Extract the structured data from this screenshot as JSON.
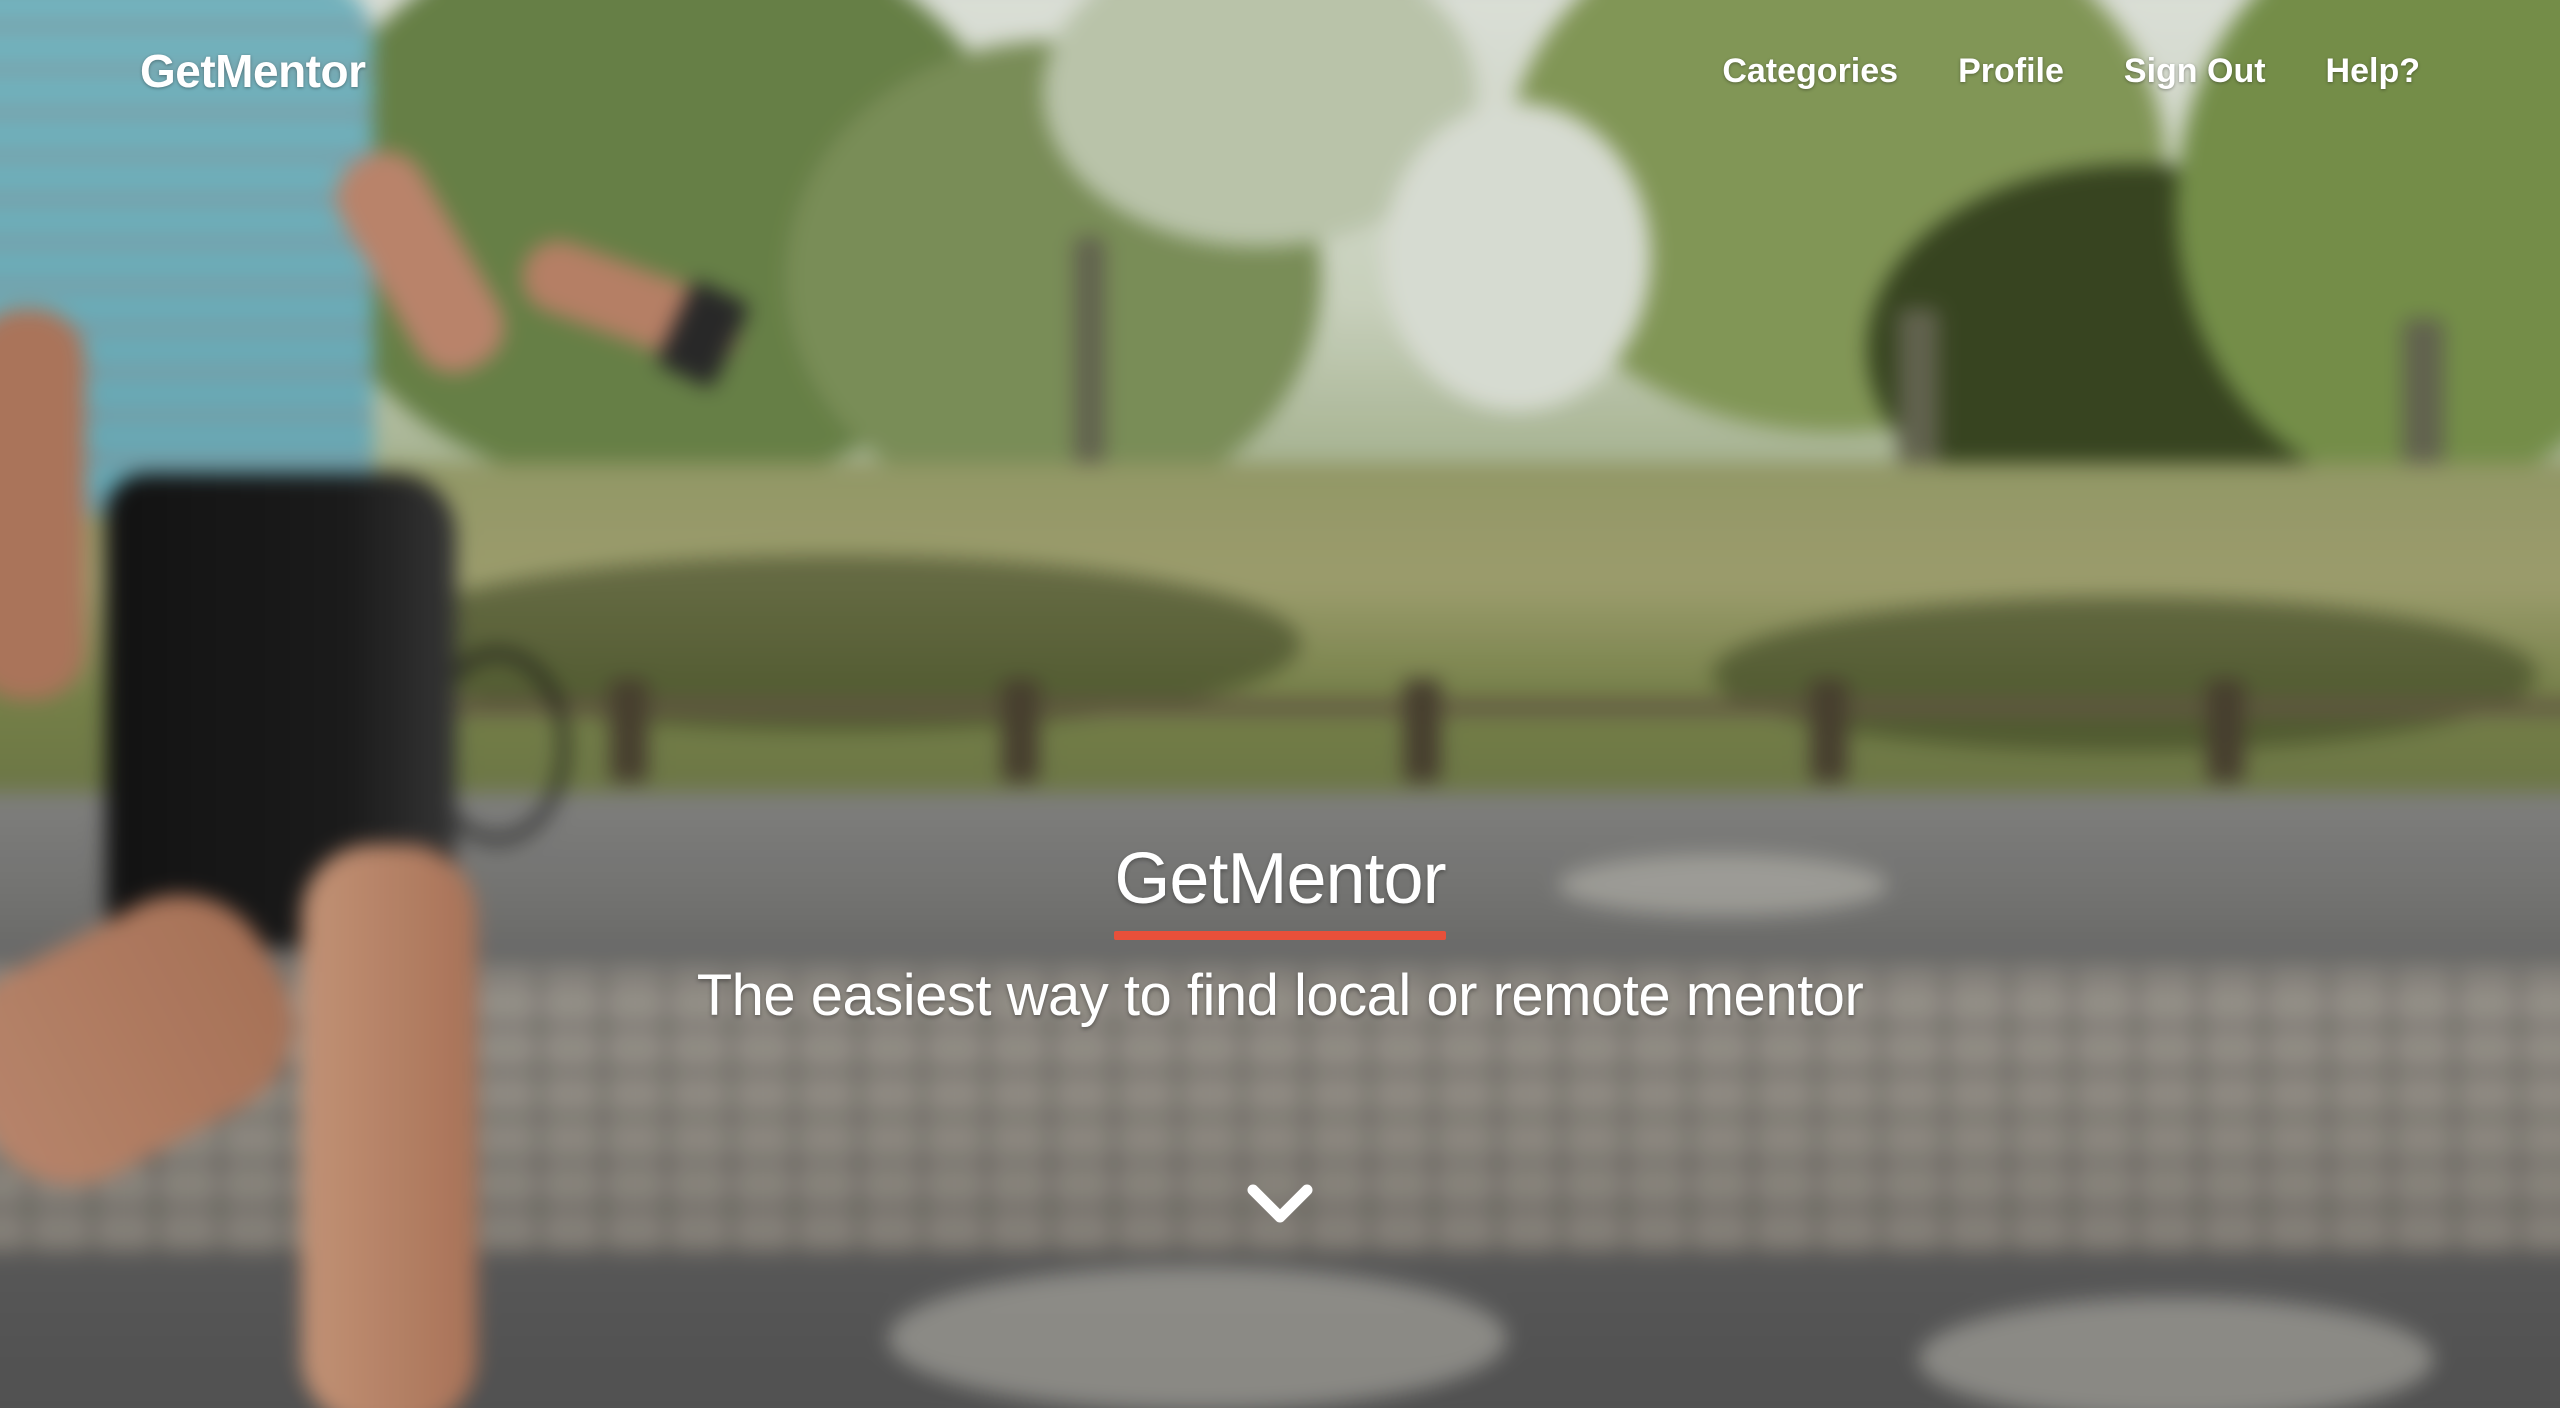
{
  "navbar": {
    "brand": "GetMentor",
    "links": [
      {
        "label": "Categories"
      },
      {
        "label": "Profile"
      },
      {
        "label": "Sign Out"
      },
      {
        "label": "Help?"
      }
    ]
  },
  "hero": {
    "title": "GetMentor",
    "tagline": "The easiest way to find local or remote mentor",
    "scroll_icon": "chevron-down-icon"
  },
  "colors": {
    "accent": "#e8503a",
    "text": "#ffffff"
  }
}
